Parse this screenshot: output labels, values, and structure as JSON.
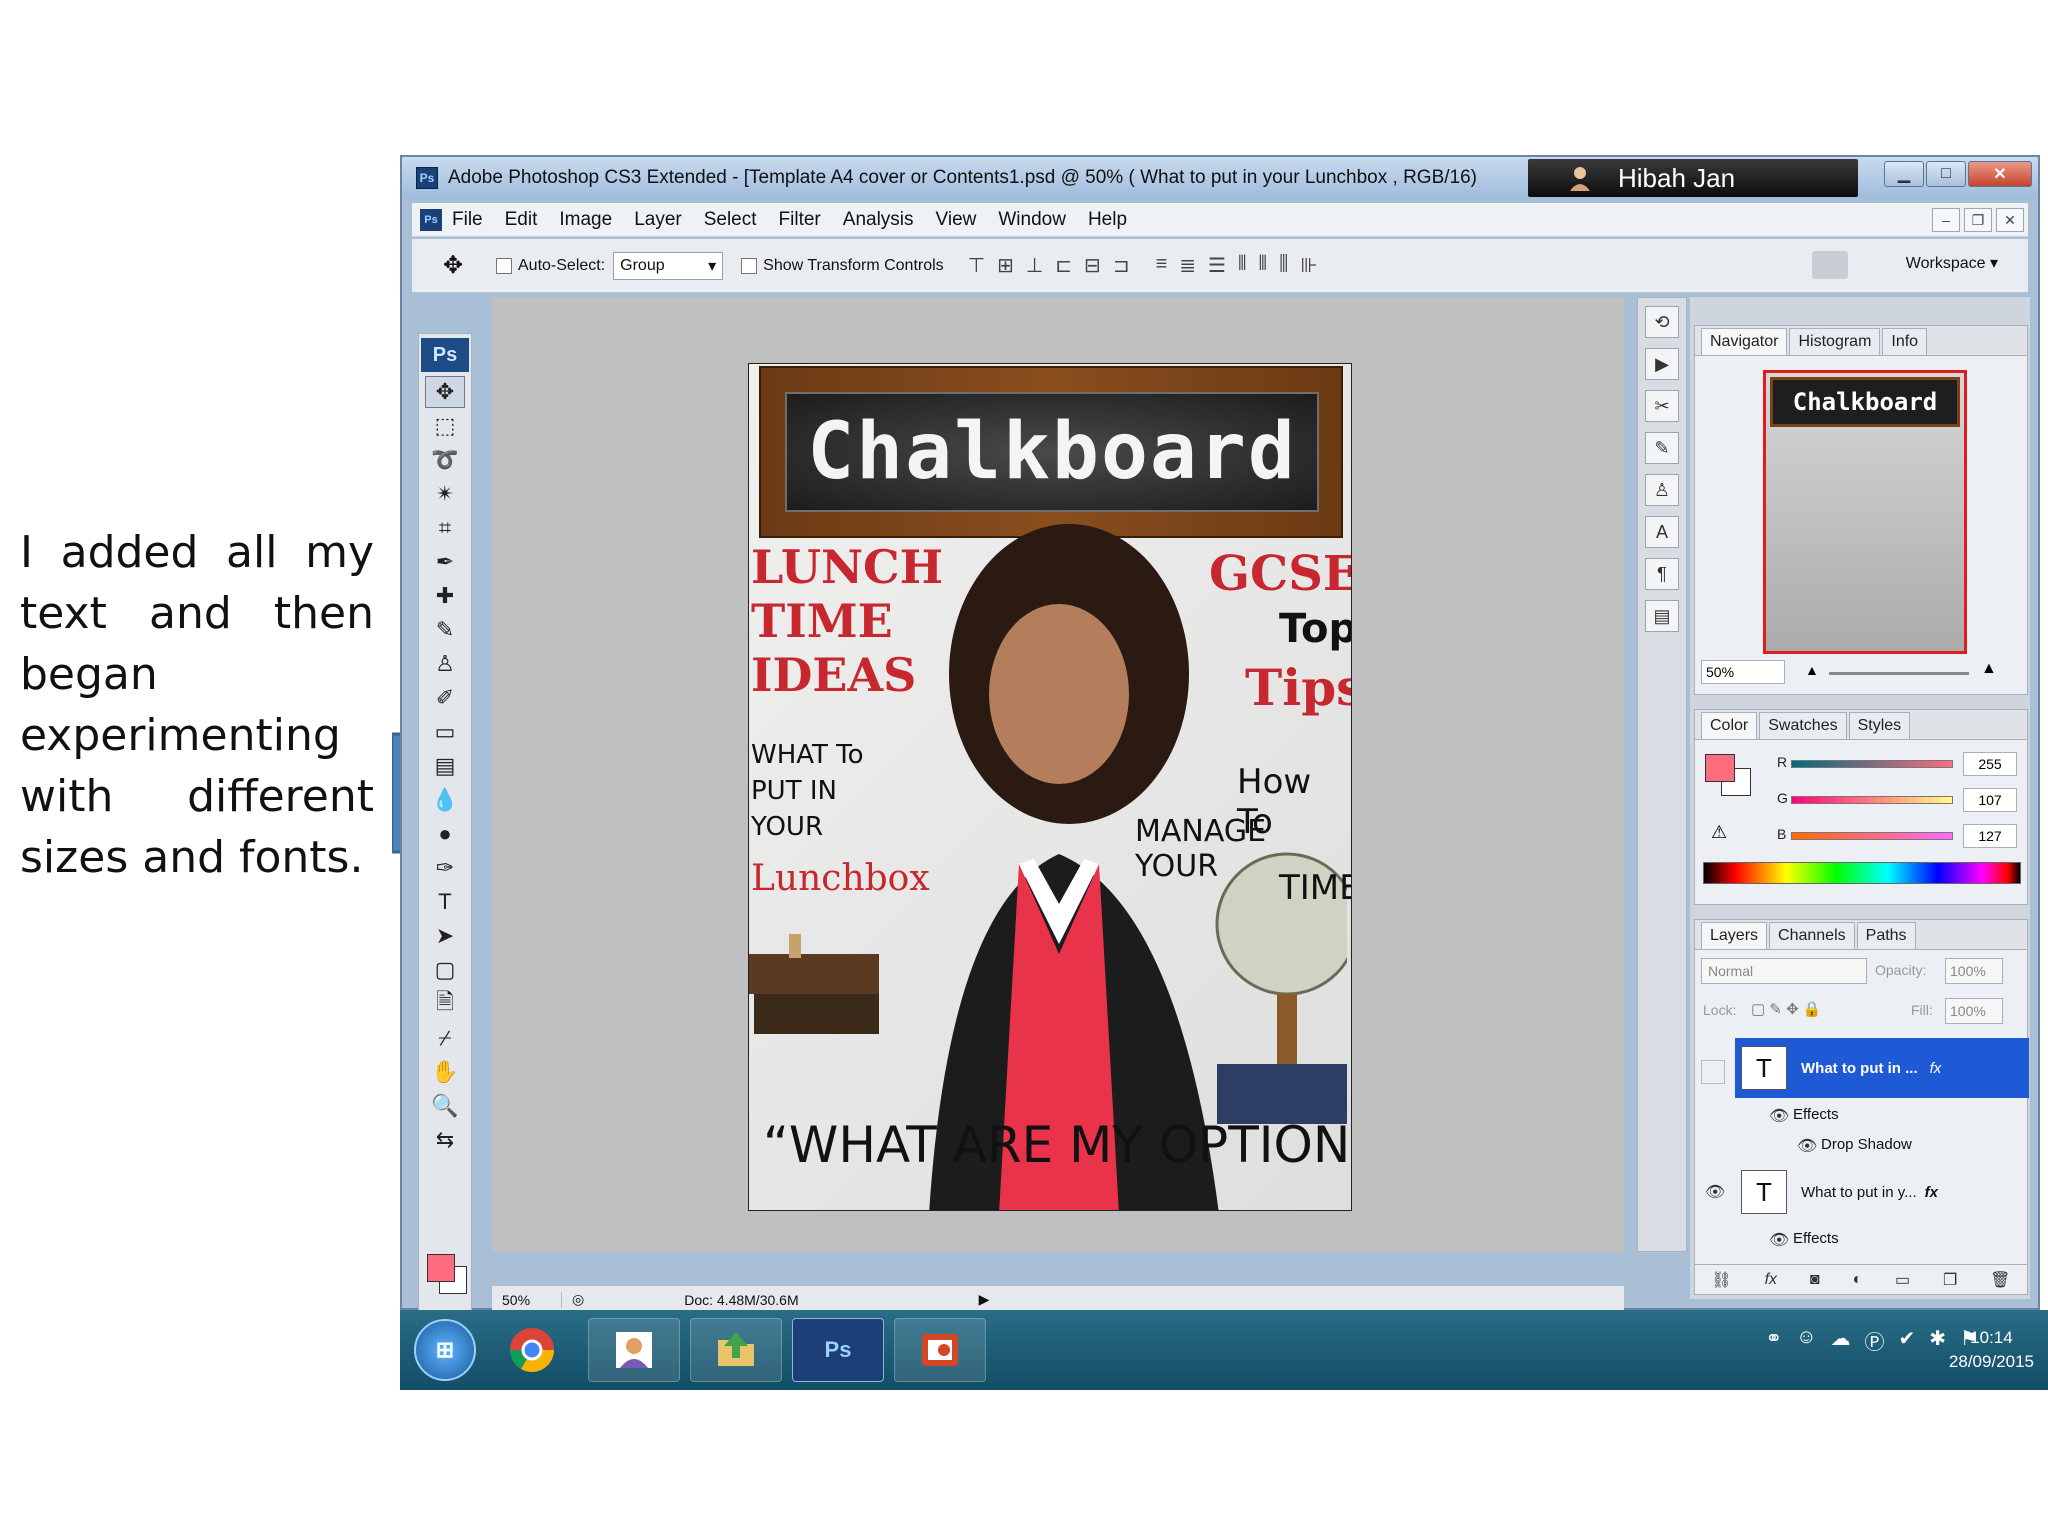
{
  "slide": {
    "caption": "I added all my text and then began experimenting with different sizes and fonts."
  },
  "window": {
    "title": "Adobe Photoshop CS3 Extended - [Template A4 cover or Contents1.psd @ 50% ( What  to  put in  your Lunchbox    , RGB/16)",
    "user_name": "Hibah Jan",
    "ps_badge": "Ps"
  },
  "menu": {
    "items": [
      "File",
      "Edit",
      "Image",
      "Layer",
      "Select",
      "Filter",
      "Analysis",
      "View",
      "Window",
      "Help"
    ]
  },
  "options_bar": {
    "auto_select_label": "Auto-Select:",
    "auto_select_value": "Group",
    "show_transform_label": "Show Transform Controls",
    "workspace_label": "Workspace"
  },
  "toolbox": {
    "logo": "Ps"
  },
  "document": {
    "chalkboard_title": "Chalkboard",
    "left_headline": [
      "LUNCH",
      "TIME",
      "IDEAS"
    ],
    "left_small": [
      "WHAT To",
      "PUT IN",
      "YOUR"
    ],
    "lunchbox": "Lunchbox",
    "gcse": "GCSE",
    "top": "Top",
    "tips": "Tips",
    "how_to": [
      "How To",
      "MANAGE YOUR",
      "TIME"
    ],
    "options": "“WHAT ARE MY OPTIONS?”"
  },
  "status_bar": {
    "zoom": "50%",
    "doc": "Doc: 4.48M/30.6M"
  },
  "navigator": {
    "tabs": [
      "Navigator",
      "Histogram",
      "Info"
    ],
    "thumb_title": "Chalkboard",
    "zoom": "50%"
  },
  "color_panel": {
    "tabs": [
      "Color",
      "Swatches",
      "Styles"
    ],
    "r_label": "R",
    "g_label": "G",
    "b_label": "B",
    "r": "255",
    "g": "107",
    "b": "127",
    "foreground_color": "#ff6b7f"
  },
  "layers_panel": {
    "tabs": [
      "Layers",
      "Channels",
      "Paths"
    ],
    "blend_mode": "Normal",
    "opacity_label": "Opacity:",
    "opacity": "100%",
    "lock_label": "Lock:",
    "fill_label": "Fill:",
    "fill": "100%",
    "layers": [
      {
        "name": "What  to  put in ...",
        "selected": true,
        "effects_label": "Effects",
        "effect": "Drop Shadow"
      },
      {
        "name": "What  to  put in  y...",
        "selected": false,
        "effects_label": "Effects"
      }
    ]
  },
  "taskbar": {
    "time": "10:14",
    "date": "28/09/2015",
    "ps_label": "Ps"
  }
}
